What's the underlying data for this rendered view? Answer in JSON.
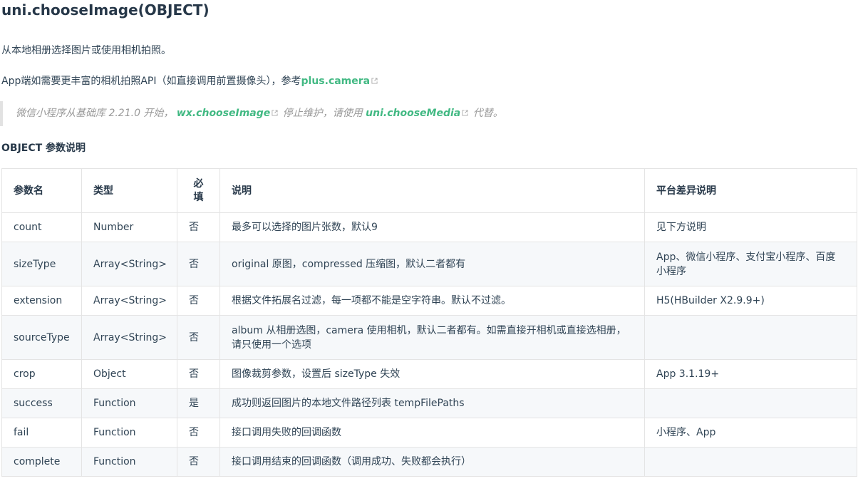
{
  "header": {
    "title": "uni.chooseImage(OBJECT)"
  },
  "intro": {
    "text": "从本地相册选择图片或使用相机拍照。"
  },
  "app_note": {
    "before": "App端如需要更丰富的相机拍照API（如直接调用前置摄像头），参考",
    "link": "plus.camera"
  },
  "tip": {
    "prefix": "微信小程序从基础库 2.21.0 开始，",
    "link1": "wx.chooseImage",
    "middle": "停止维护，请使用",
    "link2": "uni.chooseMedia",
    "suffix": "代替。"
  },
  "section": {
    "title": "OBJECT 参数说明"
  },
  "table": {
    "headers": {
      "name": "参数名",
      "type": "类型",
      "required_line1": "必",
      "required_line2": "填",
      "desc": "说明",
      "platform": "平台差异说明"
    },
    "rows": [
      {
        "name": "count",
        "type": "Number",
        "required": "否",
        "desc": "最多可以选择的图片张数，默认9",
        "platform": "见下方说明"
      },
      {
        "name": "sizeType",
        "type": "Array<String>",
        "required": "否",
        "desc": "original 原图，compressed 压缩图，默认二者都有",
        "platform": "App、微信小程序、支付宝小程序、百度小程序"
      },
      {
        "name": "extension",
        "type": "Array<String>",
        "required": "否",
        "desc": "根据文件拓展名过滤，每一项都不能是空字符串。默认不过滤。",
        "platform": "H5(HBuilder X2.9.9+)"
      },
      {
        "name": "sourceType",
        "type": "Array<String>",
        "required": "否",
        "desc": "album 从相册选图，camera 使用相机，默认二者都有。如需直接开相机或直接选相册，请只使用一个选项",
        "platform": ""
      },
      {
        "name": "crop",
        "type": "Object",
        "required": "否",
        "desc": "图像裁剪参数，设置后 sizeType 失效",
        "platform": "App 3.1.19+"
      },
      {
        "name": "success",
        "type": "Function",
        "required": "是",
        "desc": "成功则返回图片的本地文件路径列表 tempFilePaths",
        "platform": ""
      },
      {
        "name": "fail",
        "type": "Function",
        "required": "否",
        "desc": "接口调用失败的回调函数",
        "platform": "小程序、App"
      },
      {
        "name": "complete",
        "type": "Function",
        "required": "否",
        "desc": "接口调用结束的回调函数（调用成功、失败都会执行）",
        "platform": ""
      }
    ]
  },
  "colors": {
    "link": "#42b983",
    "text": "#304455",
    "tip_text": "#9a9a9a",
    "tip_border": "#e2e2e2",
    "row_alt": "#f6f8fa",
    "border": "#e4e4e4"
  }
}
